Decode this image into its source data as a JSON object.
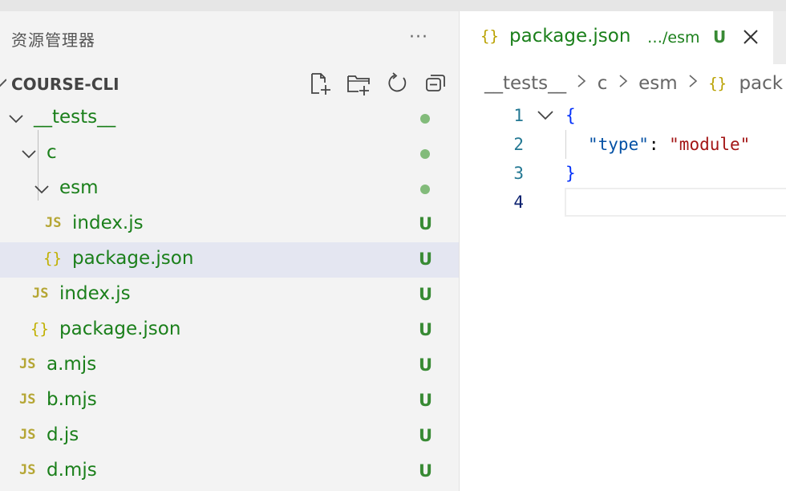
{
  "explorer": {
    "title": "资源管理器",
    "more": "···",
    "section_title": "COURSE-CLI",
    "actions": [
      "new-file-icon",
      "new-folder-icon",
      "refresh-icon",
      "collapse-all-icon"
    ]
  },
  "tree": [
    {
      "label": "__tests__",
      "type": "folder",
      "status": "dot"
    },
    {
      "label": "c",
      "type": "folder",
      "status": "dot"
    },
    {
      "label": "esm",
      "type": "folder",
      "status": "dot"
    },
    {
      "label": "index.js",
      "type": "js",
      "status": "U"
    },
    {
      "label": "package.json",
      "type": "json",
      "status": "U",
      "selected": true
    },
    {
      "label": "index.js",
      "type": "js",
      "status": "U"
    },
    {
      "label": "package.json",
      "type": "json",
      "status": "U"
    },
    {
      "label": "a.mjs",
      "type": "js",
      "status": "U"
    },
    {
      "label": "b.mjs",
      "type": "js",
      "status": "U"
    },
    {
      "label": "d.js",
      "type": "js",
      "status": "U"
    },
    {
      "label": "d.mjs",
      "type": "js",
      "status": "U"
    }
  ],
  "icons": {
    "js": "JS",
    "json": "{}"
  },
  "tab": {
    "name": "package.json",
    "description": "…/esm",
    "status": "U"
  },
  "breadcrumb": {
    "parts": [
      "__tests__",
      "c",
      "esm"
    ],
    "file": "pack"
  },
  "code": {
    "line_numbers": [
      "1",
      "2",
      "3",
      "4"
    ],
    "open_brace": "{",
    "key": "\"type\"",
    "colon": ": ",
    "value": "\"module\"",
    "close_brace": "}"
  },
  "colors": {
    "untracked_green": "#1a7f1a",
    "status_green": "#388a34",
    "dot_green": "#82bb7a",
    "selection": "#e4e6f1",
    "json_key": "#0451a5",
    "json_string": "#a31515",
    "brace": "#0431fa"
  }
}
